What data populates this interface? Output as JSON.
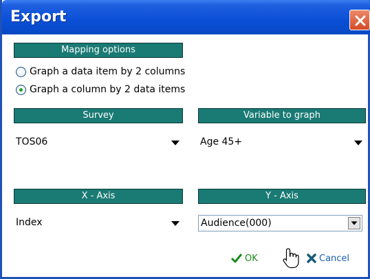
{
  "window": {
    "title": "Export"
  },
  "mapping": {
    "header": "Mapping options",
    "options": [
      {
        "label": "Graph a data item by 2 columns",
        "checked": false
      },
      {
        "label": "Graph a column by 2 data items",
        "checked": true
      }
    ]
  },
  "survey": {
    "header": "Survey",
    "value": "TOS06"
  },
  "variable": {
    "header": "Variable to graph",
    "value": "Age 45+"
  },
  "xaxis": {
    "header": "X - Axis",
    "value": "Index"
  },
  "yaxis": {
    "header": "Y - Axis",
    "value": "Audience(000)"
  },
  "buttons": {
    "ok_label": "OK",
    "cancel_label": "Cancel"
  },
  "colors": {
    "header_bg": "#1a7a74",
    "titlebar": "#0a4fd6",
    "ok": "#1a8a1a",
    "cancel": "#1a5fb0"
  },
  "icons": {
    "close": "close-icon",
    "ok": "checkmark-icon",
    "cancel": "cross-icon",
    "cursor": "hand-pointer-icon",
    "dropdown": "triangle-down-icon"
  }
}
